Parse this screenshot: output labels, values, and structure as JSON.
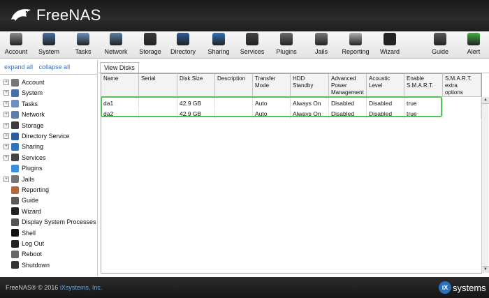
{
  "brand": {
    "name": "FreeNAS"
  },
  "colors": {
    "header_bg": "#1e1e1e",
    "accent_link": "#3a6fb0",
    "highlight_border": "#55c055"
  },
  "toolbar": {
    "items": [
      {
        "label": "Account",
        "icon": "account-icon",
        "color": "#8c8c8c"
      },
      {
        "label": "System",
        "icon": "system-icon",
        "color": "#4a6fa5"
      },
      {
        "label": "Tasks",
        "icon": "tasks-icon",
        "color": "#6d8fbd"
      },
      {
        "label": "Network",
        "icon": "network-icon",
        "color": "#5b7fa8"
      },
      {
        "label": "Storage",
        "icon": "storage-icon",
        "color": "#3b3b3b"
      },
      {
        "label": "Directory",
        "icon": "directory-icon",
        "color": "#2d5c9a"
      },
      {
        "label": "Sharing",
        "icon": "sharing-icon",
        "color": "#2f73b8"
      },
      {
        "label": "Services",
        "icon": "services-icon",
        "color": "#444444"
      },
      {
        "label": "Plugins",
        "icon": "plugins-icon",
        "color": "#6b6b6b"
      },
      {
        "label": "Jails",
        "icon": "jails-icon",
        "color": "#777777"
      },
      {
        "label": "Reporting",
        "icon": "reporting-icon",
        "color": "#b0b0b0"
      },
      {
        "label": "Wizard",
        "icon": "wizard-icon",
        "color": "#222222"
      },
      {
        "label": "Guide",
        "icon": "guide-icon",
        "color": "#5a5a5a"
      },
      {
        "label": "Alert",
        "icon": "alert-icon",
        "color": "#3fae3f"
      }
    ]
  },
  "sidebar": {
    "expand_all": "expand all",
    "collapse_all": "collapse all",
    "items": [
      {
        "label": "Account",
        "expandable": true,
        "icon": "account-icon"
      },
      {
        "label": "System",
        "expandable": true,
        "icon": "system-icon"
      },
      {
        "label": "Tasks",
        "expandable": true,
        "icon": "tasks-icon"
      },
      {
        "label": "Network",
        "expandable": true,
        "icon": "network-icon"
      },
      {
        "label": "Storage",
        "expandable": true,
        "icon": "storage-icon"
      },
      {
        "label": "Directory Service",
        "expandable": true,
        "icon": "directory-icon"
      },
      {
        "label": "Sharing",
        "expandable": true,
        "icon": "sharing-icon"
      },
      {
        "label": "Services",
        "expandable": true,
        "icon": "services-icon"
      },
      {
        "label": "Plugins",
        "expandable": false,
        "icon": "plugins-icon"
      },
      {
        "label": "Jails",
        "expandable": true,
        "icon": "jails-icon"
      },
      {
        "label": "Reporting",
        "expandable": false,
        "icon": "reporting-icon"
      },
      {
        "label": "Guide",
        "expandable": false,
        "icon": "guide-icon"
      },
      {
        "label": "Wizard",
        "expandable": false,
        "icon": "wizard-icon"
      },
      {
        "label": "Display System Processes",
        "expandable": false,
        "icon": "processes-icon"
      },
      {
        "label": "Shell",
        "expandable": false,
        "icon": "shell-icon"
      },
      {
        "label": "Log Out",
        "expandable": false,
        "icon": "logout-icon"
      },
      {
        "label": "Reboot",
        "expandable": false,
        "icon": "reboot-icon"
      },
      {
        "label": "Shutdown",
        "expandable": false,
        "icon": "shutdown-icon"
      }
    ]
  },
  "main": {
    "tab": "View Disks",
    "columns": [
      [
        "Name"
      ],
      [
        "Serial"
      ],
      [
        "Disk Size"
      ],
      [
        "Description"
      ],
      [
        "Transfer",
        "Mode"
      ],
      [
        "HDD",
        "Standby"
      ],
      [
        "Advanced",
        "Power",
        "Management"
      ],
      [
        "Acoustic",
        "Level"
      ],
      [
        "Enable",
        "S.M.A.R.T."
      ],
      [
        "S.M.A.R.T.",
        "extra",
        "options"
      ]
    ],
    "rows": [
      [
        "da1",
        "",
        "42.9 GB",
        "",
        "Auto",
        "Always On",
        "Disabled",
        "Disabled",
        "true",
        ""
      ],
      [
        "da2",
        "",
        "42.9 GB",
        "",
        "Auto",
        "Always On",
        "Disabled",
        "Disabled",
        "true",
        ""
      ]
    ]
  },
  "footer": {
    "copyright": "FreeNAS® © 2016",
    "company_link": "iXsystems, Inc.",
    "logo_badge": "iX",
    "logo_text": "systems"
  }
}
